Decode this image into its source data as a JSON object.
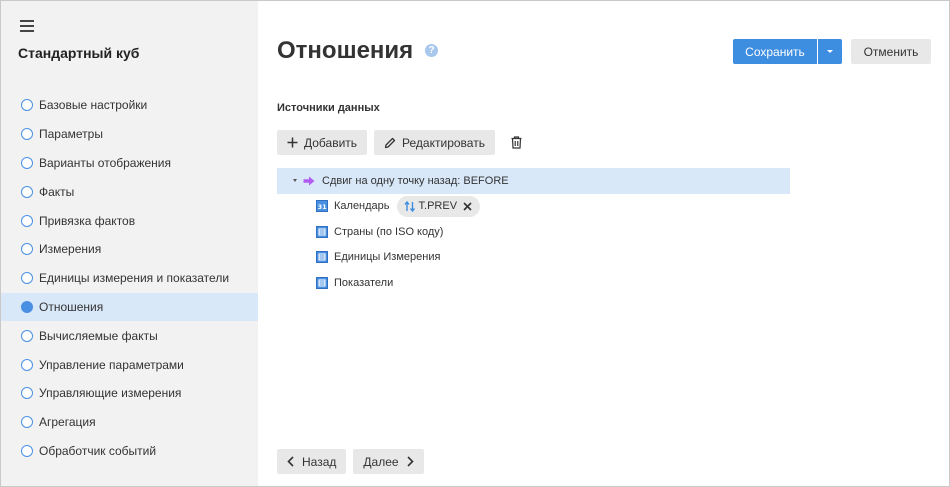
{
  "sidebar": {
    "title": "Стандартный куб",
    "menu_icon": "hamburger-icon",
    "items": [
      {
        "label": "Базовые настройки",
        "active": false
      },
      {
        "label": "Параметры",
        "active": false
      },
      {
        "label": "Варианты отображения",
        "active": false
      },
      {
        "label": "Факты",
        "active": false
      },
      {
        "label": "Привязка фактов",
        "active": false
      },
      {
        "label": "Измерения",
        "active": false
      },
      {
        "label": "Единицы измерения и показатели",
        "active": false
      },
      {
        "label": "Отношения",
        "active": true
      },
      {
        "label": "Вычисляемые факты",
        "active": false
      },
      {
        "label": "Управление параметрами",
        "active": false
      },
      {
        "label": "Управляющие измерения",
        "active": false
      },
      {
        "label": "Агрегация",
        "active": false
      },
      {
        "label": "Обработчик событий",
        "active": false
      }
    ]
  },
  "header": {
    "title": "Отношения",
    "help_symbol": "?",
    "save_label": "Сохранить",
    "cancel_label": "Отменить"
  },
  "sources": {
    "label": "Источники данных",
    "add_label": "Добавить",
    "edit_label": "Редактировать"
  },
  "tree": {
    "root_label": "Сдвиг на одну точку назад: BEFORE",
    "children": [
      {
        "label": "Календарь",
        "icon": "calendar-dimension-icon",
        "chip": "T.PREV"
      },
      {
        "label": "Страны (по ISO коду)",
        "icon": "dictionary-icon"
      },
      {
        "label": "Единицы Измерения",
        "icon": "dictionary-icon"
      },
      {
        "label": "Показатели",
        "icon": "dictionary-icon"
      }
    ]
  },
  "footer": {
    "back_label": "Назад",
    "next_label": "Далее"
  },
  "colors": {
    "accent": "#3d8de0",
    "sidebar_bg": "#f2f2f2",
    "selection_bg": "#d9e8f9",
    "relation_arrow": "#b05cf0"
  }
}
